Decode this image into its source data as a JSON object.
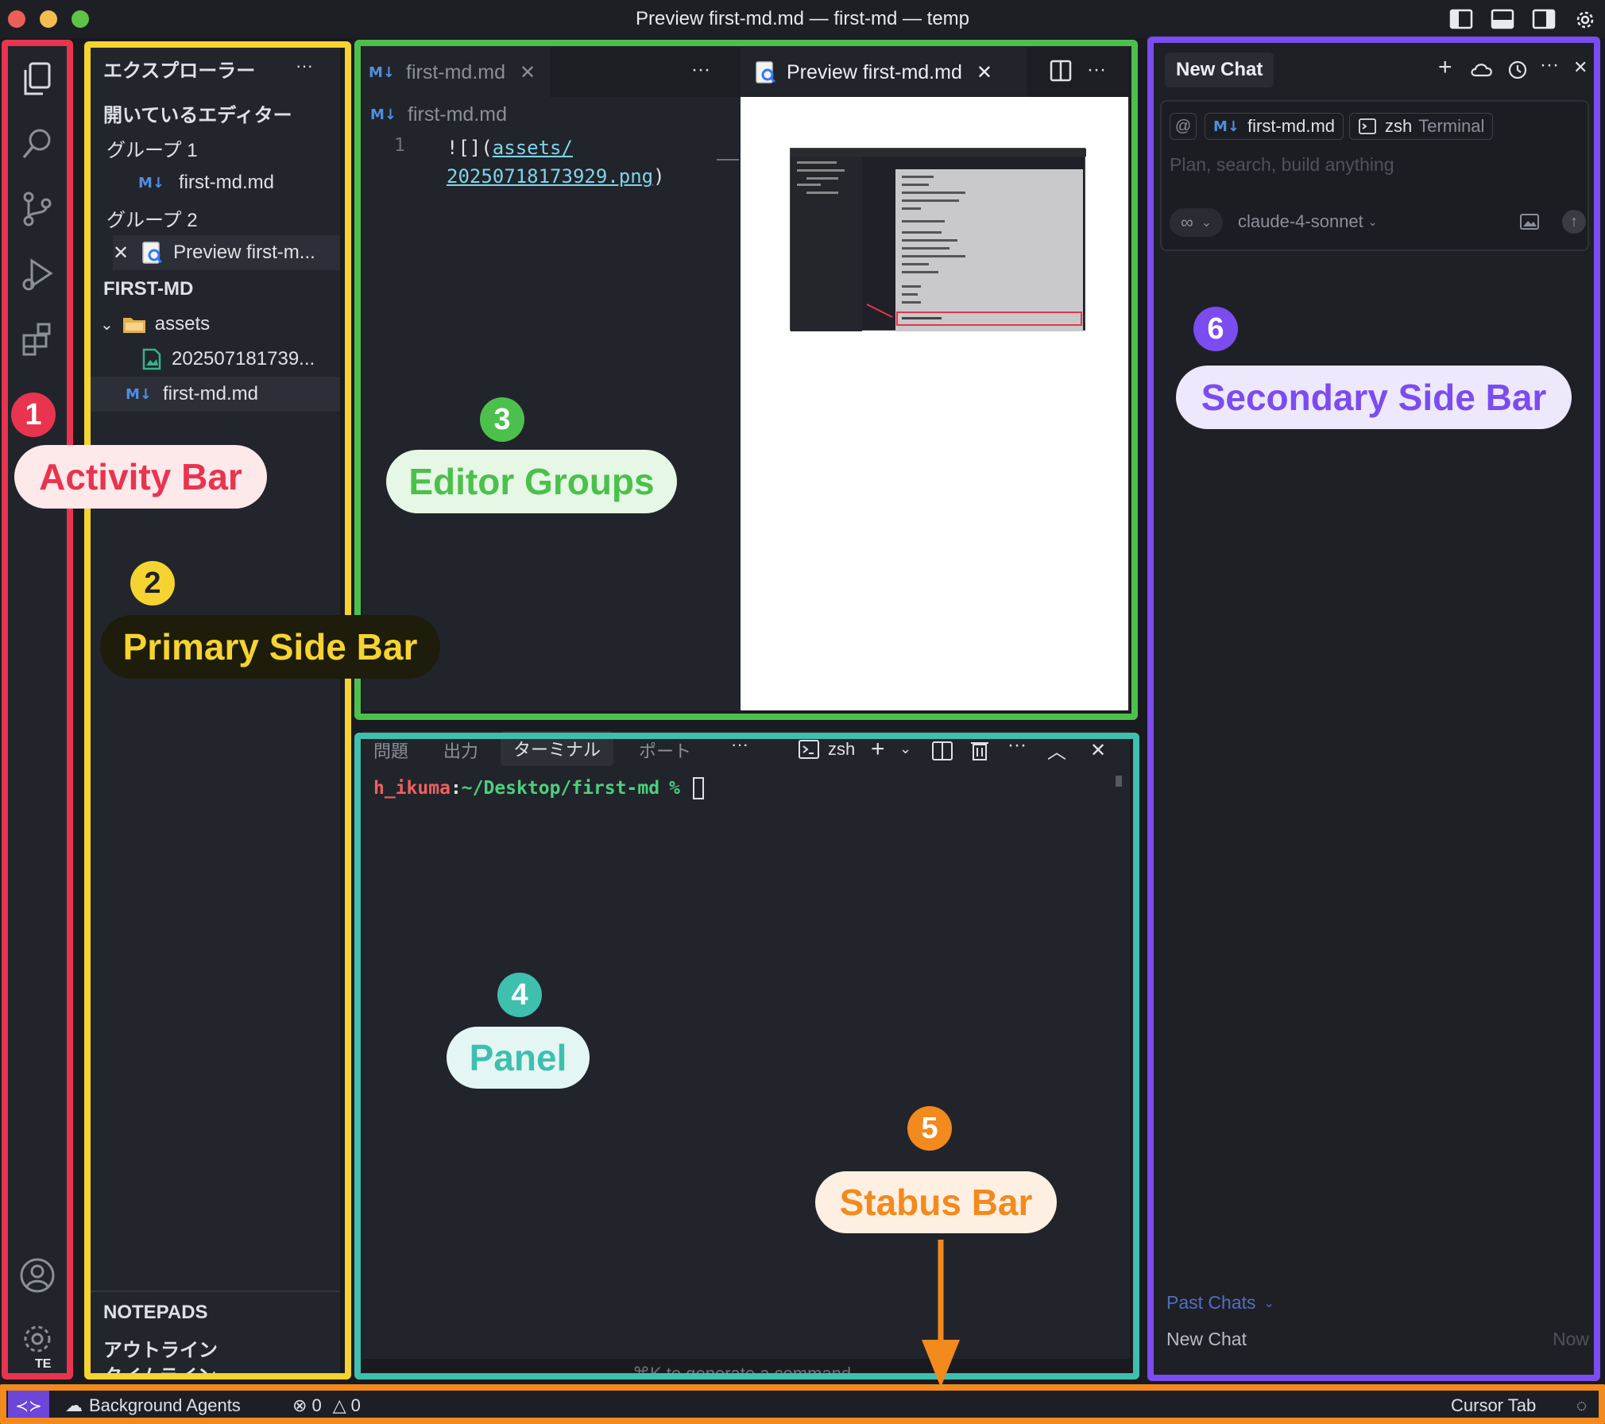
{
  "window": {
    "title": "Preview first-md.md — first-md — temp"
  },
  "activity_bar": {
    "account_initials": "TE"
  },
  "explorer": {
    "title": "エクスプローラー",
    "more": "···",
    "open_editors_header": "開いているエディター",
    "group1_label": "グループ 1",
    "group1_file": "first-md.md",
    "group2_label": "グループ 2",
    "group2_file": "Preview first-m...",
    "project_header": "FIRST-MD",
    "folder": "assets",
    "image_file": "202507181739...",
    "md_file": "first-md.md",
    "notepads": "NOTEPADS",
    "outline": "アウトライン",
    "timeline": "タイムライン"
  },
  "editor": {
    "left_tab": "first-md.md",
    "left_more": "···",
    "breadcrumb": "first-md.md",
    "line_number": "1",
    "code_prefix": "![](",
    "code_link_1": "assets/",
    "code_link_2": "20250718173929.png",
    "code_suffix": ")",
    "right_tab": "Preview first-md.md",
    "right_more": "···"
  },
  "panel": {
    "tabs": [
      "問題",
      "出力",
      "ターミナル",
      "ポート"
    ],
    "more": "···",
    "shell": "zsh",
    "prompt_user": "h_ikuma",
    "prompt_sep": ":",
    "prompt_path": "~/Desktop/first-md",
    "prompt_symbol": "%",
    "hint": "⌘K to generate a command"
  },
  "chat": {
    "tab": "New Chat",
    "context_at": "@",
    "context_file": "first-md.md",
    "context_terminal_name": "zsh",
    "context_terminal_type": "Terminal",
    "placeholder": "Plan, search, build anything",
    "mode_symbol": "∞",
    "model": "claude-4-sonnet",
    "past_chats": "Past Chats",
    "history_item": "New Chat",
    "history_time": "Now"
  },
  "statusbar": {
    "background_agents": "Background Agents",
    "errors": "0",
    "warnings": "0",
    "cursor_tab": "Cursor Tab"
  },
  "annotations": {
    "activity": {
      "num": "1",
      "label": "Activity Bar",
      "color": "#e8344f"
    },
    "primary": {
      "num": "2",
      "label": "Primary Side Bar",
      "color": "#f5d431"
    },
    "editor": {
      "num": "3",
      "label": "Editor Groups",
      "color": "#4cc04c"
    },
    "panel": {
      "num": "4",
      "label": "Panel",
      "color": "#3fbfae"
    },
    "status": {
      "num": "5",
      "label": "Stabus Bar",
      "color": "#f28a1e"
    },
    "secondary": {
      "num": "6",
      "label": "Secondary Side Bar",
      "color": "#7b4cf0"
    }
  }
}
